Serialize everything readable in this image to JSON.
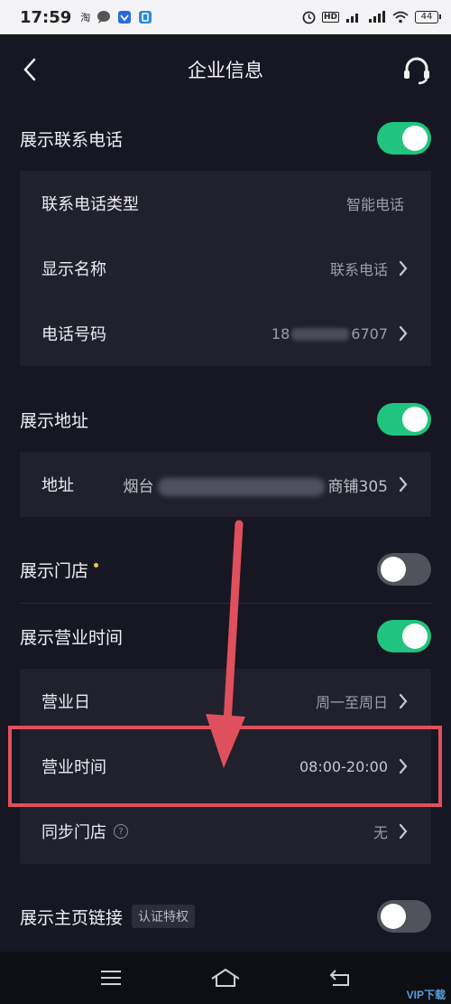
{
  "status_bar": {
    "time": "17:59",
    "left_icons": [
      "taobao-icon",
      "chat-icon",
      "shield-icon",
      "app-icon"
    ],
    "right_icons": [
      "alarm-icon",
      "hd-icon",
      "signal-g-icon",
      "signal-5g-icon",
      "wifi-icon"
    ],
    "battery": "44"
  },
  "header": {
    "title": "企业信息",
    "back_icon": "chevron-left-icon",
    "support_icon": "headset-icon"
  },
  "sections": {
    "contact": {
      "label": "展示联系电话",
      "toggle": true,
      "rows": [
        {
          "label": "联系电话类型",
          "value": "智能电话",
          "arrow": false
        },
        {
          "label": "显示名称",
          "value": "联系电话",
          "arrow": true
        },
        {
          "label": "电话号码",
          "value": "18",
          "value_tail": "6707",
          "arrow": true
        }
      ]
    },
    "address": {
      "label": "展示地址",
      "toggle": true,
      "rows": [
        {
          "label": "地址",
          "value": "烟台",
          "value_tail": "商铺305",
          "arrow": true
        }
      ]
    },
    "store": {
      "label": "展示门店",
      "toggle": false,
      "has_dot": true
    },
    "hours": {
      "label": "展示营业时间",
      "toggle": true,
      "rows": [
        {
          "label": "营业日",
          "value": "周一至周日",
          "arrow": true
        },
        {
          "label": "营业时间",
          "value": "08:00-20:00",
          "arrow": true
        },
        {
          "label": "同步门店",
          "value": "无",
          "arrow": true,
          "help": "?"
        }
      ]
    },
    "homepage": {
      "label": "展示主页链接",
      "badge": "认证特权",
      "toggle": false
    }
  },
  "nav": {
    "icons": [
      "menu-icon",
      "home-icon",
      "back-icon"
    ]
  },
  "watermark": "VIP下载",
  "colors": {
    "background": "#161722",
    "card": "#20212c",
    "toggle_on": "#20c47e",
    "toggle_off": "#50525c",
    "annotation": "#e0505c"
  }
}
